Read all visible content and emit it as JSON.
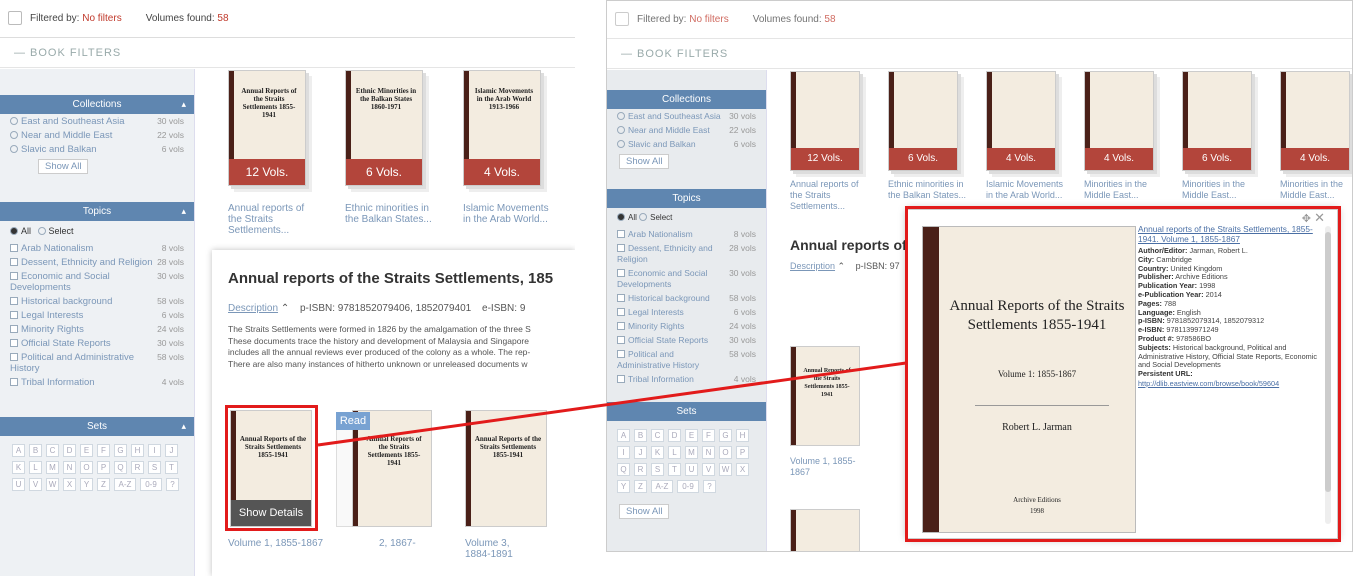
{
  "left": {
    "topbar": {
      "filtered_label": "Filtered by:",
      "filtered_value": "No filters",
      "volumes_label": "Volumes found:",
      "volumes_count": "58"
    },
    "book_filters": "BOOK FILTERS",
    "collections": {
      "title": "Collections",
      "items": [
        {
          "label": "East and Southeast Asia",
          "count": "30 vols"
        },
        {
          "label": "Near and Middle East",
          "count": "22 vols"
        },
        {
          "label": "Slavic and Balkan",
          "count": "6 vols"
        }
      ],
      "show_all": "Show All"
    },
    "topics": {
      "title": "Topics",
      "all": "All",
      "select": "Select",
      "items": [
        {
          "label": "Arab Nationalism",
          "count": "8 vols"
        },
        {
          "label": "Dessent, Ethnicity and Religion",
          "count": "28 vols"
        },
        {
          "label": "Economic and Social Developments",
          "count": "30 vols"
        },
        {
          "label": "Historical background",
          "count": "58 vols"
        },
        {
          "label": "Legal Interests",
          "count": "6 vols"
        },
        {
          "label": "Minority Rights",
          "count": "24 vols"
        },
        {
          "label": "Official State Reports",
          "count": "30 vols"
        },
        {
          "label": "Political and Administrative History",
          "count": "58 vols"
        },
        {
          "label": "Tribal Information",
          "count": "4 vols"
        }
      ]
    },
    "sets": {
      "title": "Sets",
      "letters": [
        "A",
        "B",
        "C",
        "D",
        "E",
        "F",
        "G",
        "H",
        "I",
        "J",
        "K",
        "L",
        "M",
        "N",
        "O",
        "P",
        "Q",
        "R",
        "S",
        "T",
        "U",
        "V",
        "W",
        "X",
        "Y",
        "Z",
        "A-Z",
        "0-9",
        "?"
      ]
    },
    "books": [
      {
        "cover": "Annual Reports of the Straits Settlements 1855-1941",
        "vols": "12 Vols.",
        "title": "Annual reports of the Straits Settlements..."
      },
      {
        "cover": "Ethnic Minorities in the Balkan States 1860-1971",
        "vols": "6 Vols.",
        "title": "Ethnic minorities in the Balkan States..."
      },
      {
        "cover": "Islamic Movements in the Arab World 1913-1966",
        "vols": "4 Vols.",
        "title": "Islamic Movements in the Arab World..."
      }
    ],
    "detail": {
      "title": "Annual reports of the Straits Settlements, 185",
      "description": "Description",
      "isbn": "p-ISBN: 9781852079406, 1852079401",
      "eisbn": "e-ISBN: 9",
      "para": [
        "The Straits Settlements were formed in 1826 by the amalgamation of the three S",
        "These documents trace the history and development of Malaysia and Singapore",
        "includes all the annual reviews ever produced of the colony as a whole. The rep-",
        "There are also many instances of hitherto unknown or unreleased documents w"
      ],
      "read": "Read",
      "show_details": "Show Details",
      "volumes": [
        "Volume 1, 1855-1867",
        "2, 1867-",
        "Volume 3, 1884-1891"
      ]
    }
  },
  "right": {
    "topbar": {
      "filtered_label": "Filtered by:",
      "filtered_value": "No filters",
      "volumes_label": "Volumes found:",
      "volumes_count": "58"
    },
    "book_filters": "BOOK FILTERS",
    "collections": {
      "title": "Collections",
      "items": [
        {
          "label": "East and Southeast Asia",
          "count": "30 vols"
        },
        {
          "label": "Near and Middle East",
          "count": "22 vols"
        },
        {
          "label": "Slavic and Balkan",
          "count": "6 vols"
        }
      ],
      "show_all": "Show All"
    },
    "topics": {
      "title": "Topics",
      "all": "All",
      "select": "Select",
      "items": [
        {
          "label": "Arab Nationalism",
          "count": "8 vols"
        },
        {
          "label": "Dessent, Ethnicity and Religion",
          "count": "28 vols"
        },
        {
          "label": "Economic and Social Developments",
          "count": "30 vols"
        },
        {
          "label": "Historical background",
          "count": "58 vols"
        },
        {
          "label": "Legal Interests",
          "count": "6 vols"
        },
        {
          "label": "Minority Rights",
          "count": "24 vols"
        },
        {
          "label": "Official State Reports",
          "count": "30 vols"
        },
        {
          "label": "Political and Administrative History",
          "count": "58 vols"
        },
        {
          "label": "Tribal Information",
          "count": "4 vols"
        }
      ]
    },
    "sets": {
      "title": "Sets",
      "show_all": "Show All"
    },
    "books": [
      {
        "vols": "12 Vols.",
        "title": "Annual reports of the Straits Settlements..."
      },
      {
        "vols": "6 Vols.",
        "title": "Ethnic minorities in the Balkan States..."
      },
      {
        "vols": "4 Vols.",
        "title": "Islamic Movements in the Arab World..."
      },
      {
        "vols": "4 Vols.",
        "title": "Minorities in the Middle East..."
      },
      {
        "vols": "6 Vols.",
        "title": "Minorities in the Middle East..."
      },
      {
        "vols": "4 Vols.",
        "title": "Minorities in the Middle East..."
      }
    ],
    "detail_title": "Annual reports of t",
    "description": "Description",
    "isbn": "p-ISBN: 97",
    "volume_label": "Volume 1, 1855-1867",
    "popup": {
      "link": "Annual reports of the Straits Settlements, 1855-1941. Volume 1, 1855-1867",
      "cover_title": "Annual Reports of the Straits Settlements 1855-1941",
      "cover_volume": "Volume 1: 1855-1867",
      "cover_author": "Robert L. Jarman",
      "cover_publisher": "Archive Editions",
      "cover_year": "1998",
      "fields": [
        {
          "k": "Author/Editor:",
          "v": "Jarman, Robert L."
        },
        {
          "k": "City:",
          "v": "Cambridge"
        },
        {
          "k": "Country:",
          "v": "United Kingdom"
        },
        {
          "k": "Publisher:",
          "v": "Archive Editions"
        },
        {
          "k": "Publication Year:",
          "v": "1998"
        },
        {
          "k": "e-Publication Year:",
          "v": "2014"
        },
        {
          "k": "Pages:",
          "v": "788"
        },
        {
          "k": "Language:",
          "v": "English"
        },
        {
          "k": "p-ISBN:",
          "v": "9781852079314, 1852079312"
        },
        {
          "k": "e-ISBN:",
          "v": "9781139971249"
        },
        {
          "k": "Product #:",
          "v": "978586BO"
        },
        {
          "k": "Subjects:",
          "v": "Historical background, Political and Administrative History, Official State Reports, Economic and Social Developments"
        },
        {
          "k": "Persistent URL:",
          "v": ""
        }
      ],
      "url": "http://dlib.eastview.com/browse/book/59604"
    }
  },
  "colors": {
    "accent": "#5f86b0",
    "vols_badge": "#b3453b",
    "highlight": "#e21b1b",
    "link": "#7b97b8"
  }
}
